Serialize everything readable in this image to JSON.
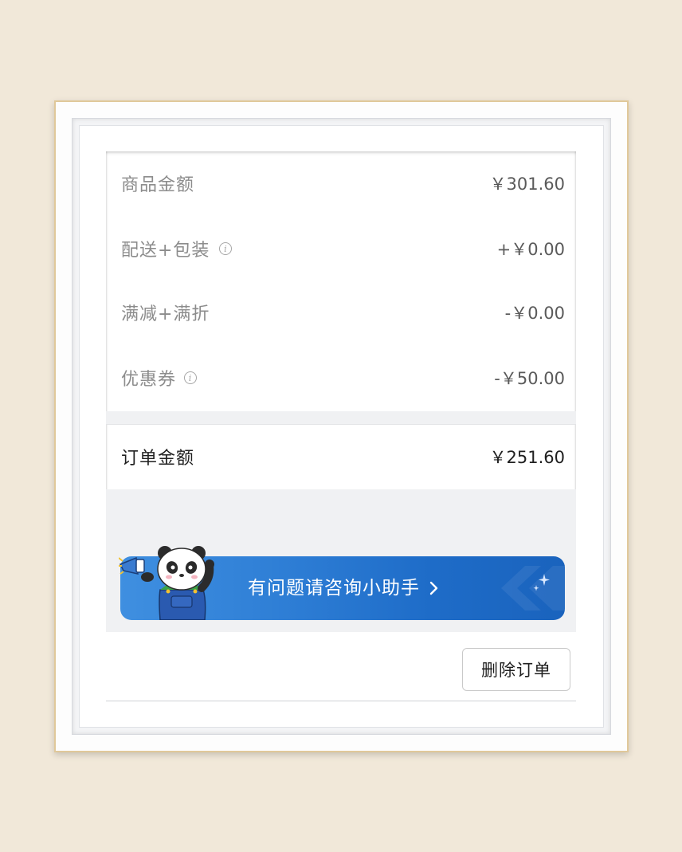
{
  "summary": {
    "items": [
      {
        "label": "商品金额",
        "value": "￥301.60",
        "info": false
      },
      {
        "label": "配送+包装",
        "value": "+￥0.00",
        "info": true
      },
      {
        "label": "满减+满折",
        "value": "-￥0.00",
        "info": false
      },
      {
        "label": "优惠券",
        "value": "-￥50.00",
        "info": true
      }
    ]
  },
  "total": {
    "label": "订单金额",
    "value": "￥251.60"
  },
  "helper_banner": {
    "text": "有问题请咨询小助手",
    "icon": "chevron-right-icon",
    "mascot": "panda-mascot",
    "color": "#2f7fd6"
  },
  "actions": {
    "delete_label": "删除订单"
  }
}
